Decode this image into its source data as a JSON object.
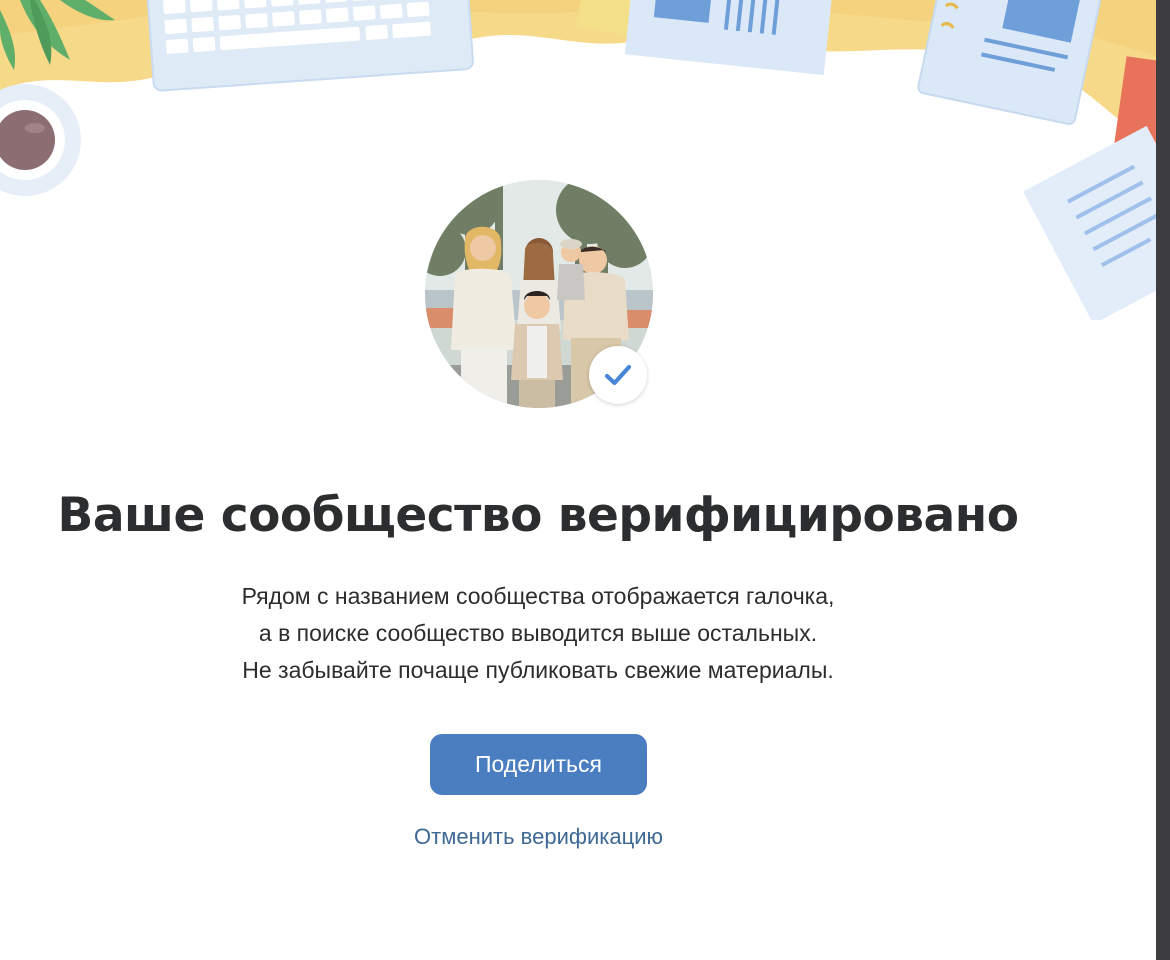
{
  "dialog": {
    "title": "Ваше сообщество верифицировано",
    "description_lines": [
      "Рядом с названием сообщества отображается галочка,",
      "а в поиске сообщество выводится выше остальных.",
      "Не забывайте почаще публиковать свежие материалы."
    ],
    "share_button_label": "Поделиться",
    "cancel_link_label": "Отменить верификацию"
  },
  "colors": {
    "accent": "#4a7ec1",
    "link": "#3f6995",
    "text": "#2c2d2e",
    "header_yellow": "#f7d98a",
    "checkmark": "#4a86d8"
  },
  "icons": {
    "badge": "checkmark-icon"
  }
}
